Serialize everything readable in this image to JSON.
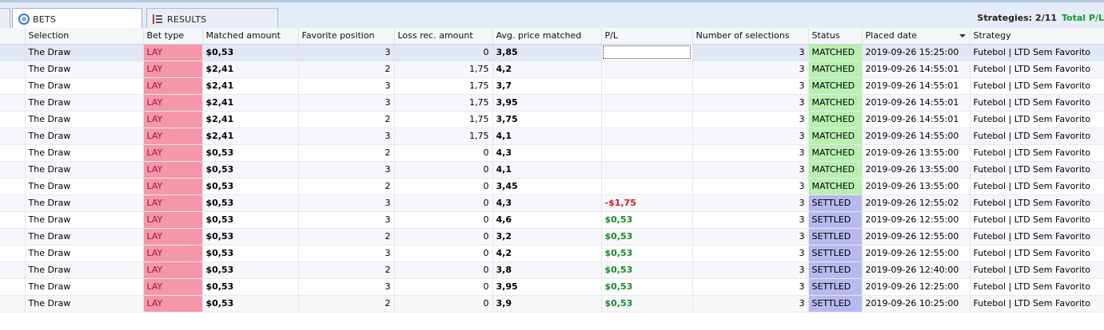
{
  "tabs": {
    "bets_label": "BETS",
    "results_label": "RESULTS"
  },
  "summary": {
    "strategies": "Strategies: 2/11",
    "total_pl": "Total P/L"
  },
  "columns": [
    "Selection",
    "Bet type",
    "Matched amount",
    "Favorite position",
    "Loss rec. amount",
    "Avg. price matched",
    "P/L",
    "Number of selections",
    "Status",
    "Placed date",
    "Strategy"
  ],
  "rows": [
    {
      "selection": "The Draw",
      "bet_type": "LAY",
      "matched": "$0,53",
      "fav_pos": "3",
      "loss_rec": "0",
      "avg_price": "3,85",
      "pl": "",
      "num_sel": "3",
      "status": "MATCHED",
      "placed": "2019-09-26 15:25:00",
      "strategy": "Futebol | LTD Sem Favorito"
    },
    {
      "selection": "The Draw",
      "bet_type": "LAY",
      "matched": "$2,41",
      "fav_pos": "2",
      "loss_rec": "1,75",
      "avg_price": "4,2",
      "pl": "",
      "num_sel": "3",
      "status": "MATCHED",
      "placed": "2019-09-26 14:55:01",
      "strategy": "Futebol | LTD Sem Favorito"
    },
    {
      "selection": "The Draw",
      "bet_type": "LAY",
      "matched": "$2,41",
      "fav_pos": "3",
      "loss_rec": "1,75",
      "avg_price": "3,7",
      "pl": "",
      "num_sel": "3",
      "status": "MATCHED",
      "placed": "2019-09-26 14:55:01",
      "strategy": "Futebol | LTD Sem Favorito"
    },
    {
      "selection": "The Draw",
      "bet_type": "LAY",
      "matched": "$2,41",
      "fav_pos": "3",
      "loss_rec": "1,75",
      "avg_price": "3,95",
      "pl": "",
      "num_sel": "3",
      "status": "MATCHED",
      "placed": "2019-09-26 14:55:01",
      "strategy": "Futebol | LTD Sem Favorito"
    },
    {
      "selection": "The Draw",
      "bet_type": "LAY",
      "matched": "$2,41",
      "fav_pos": "2",
      "loss_rec": "1,75",
      "avg_price": "3,75",
      "pl": "",
      "num_sel": "3",
      "status": "MATCHED",
      "placed": "2019-09-26 14:55:01",
      "strategy": "Futebol | LTD Sem Favorito"
    },
    {
      "selection": "The Draw",
      "bet_type": "LAY",
      "matched": "$2,41",
      "fav_pos": "3",
      "loss_rec": "1,75",
      "avg_price": "4,1",
      "pl": "",
      "num_sel": "3",
      "status": "MATCHED",
      "placed": "2019-09-26 14:55:00",
      "strategy": "Futebol | LTD Sem Favorito"
    },
    {
      "selection": "The Draw",
      "bet_type": "LAY",
      "matched": "$0,53",
      "fav_pos": "2",
      "loss_rec": "0",
      "avg_price": "4,3",
      "pl": "",
      "num_sel": "3",
      "status": "MATCHED",
      "placed": "2019-09-26 13:55:00",
      "strategy": "Futebol | LTD Sem Favorito"
    },
    {
      "selection": "The Draw",
      "bet_type": "LAY",
      "matched": "$0,53",
      "fav_pos": "3",
      "loss_rec": "0",
      "avg_price": "4,1",
      "pl": "",
      "num_sel": "3",
      "status": "MATCHED",
      "placed": "2019-09-26 13:55:00",
      "strategy": "Futebol | LTD Sem Favorito"
    },
    {
      "selection": "The Draw",
      "bet_type": "LAY",
      "matched": "$0,53",
      "fav_pos": "2",
      "loss_rec": "0",
      "avg_price": "3,45",
      "pl": "",
      "num_sel": "3",
      "status": "MATCHED",
      "placed": "2019-09-26 13:55:00",
      "strategy": "Futebol | LTD Sem Favorito"
    },
    {
      "selection": "The Draw",
      "bet_type": "LAY",
      "matched": "$0,53",
      "fav_pos": "3",
      "loss_rec": "0",
      "avg_price": "4,3",
      "pl": "-$1,75",
      "num_sel": "3",
      "status": "SETTLED",
      "placed": "2019-09-26 12:55:02",
      "strategy": "Futebol | LTD Sem Favorito"
    },
    {
      "selection": "The Draw",
      "bet_type": "LAY",
      "matched": "$0,53",
      "fav_pos": "3",
      "loss_rec": "0",
      "avg_price": "4,6",
      "pl": "$0,53",
      "num_sel": "3",
      "status": "SETTLED",
      "placed": "2019-09-26 12:55:00",
      "strategy": "Futebol | LTD Sem Favorito"
    },
    {
      "selection": "The Draw",
      "bet_type": "LAY",
      "matched": "$0,53",
      "fav_pos": "2",
      "loss_rec": "0",
      "avg_price": "3,2",
      "pl": "$0,53",
      "num_sel": "3",
      "status": "SETTLED",
      "placed": "2019-09-26 12:55:00",
      "strategy": "Futebol | LTD Sem Favorito"
    },
    {
      "selection": "The Draw",
      "bet_type": "LAY",
      "matched": "$0,53",
      "fav_pos": "3",
      "loss_rec": "0",
      "avg_price": "4,2",
      "pl": "$0,53",
      "num_sel": "3",
      "status": "SETTLED",
      "placed": "2019-09-26 12:55:00",
      "strategy": "Futebol | LTD Sem Favorito"
    },
    {
      "selection": "The Draw",
      "bet_type": "LAY",
      "matched": "$0,53",
      "fav_pos": "2",
      "loss_rec": "0",
      "avg_price": "3,8",
      "pl": "$0,53",
      "num_sel": "3",
      "status": "SETTLED",
      "placed": "2019-09-26 12:40:00",
      "strategy": "Futebol | LTD Sem Favorito"
    },
    {
      "selection": "The Draw",
      "bet_type": "LAY",
      "matched": "$0,53",
      "fav_pos": "3",
      "loss_rec": "0",
      "avg_price": "3,95",
      "pl": "$0,53",
      "num_sel": "3",
      "status": "SETTLED",
      "placed": "2019-09-26 12:25:00",
      "strategy": "Futebol | LTD Sem Favorito"
    },
    {
      "selection": "The Draw",
      "bet_type": "LAY",
      "matched": "$0,53",
      "fav_pos": "2",
      "loss_rec": "0",
      "avg_price": "3,9",
      "pl": "$0,53",
      "num_sel": "3",
      "status": "SETTLED",
      "placed": "2019-09-26 10:25:00",
      "strategy": "Futebol | LTD Sem Favorito"
    }
  ],
  "colors": {
    "lay_bg": "#f497a8",
    "matched_bg": "#b8f0b0",
    "settled_bg": "#b8b8f0",
    "pl_negative": "#d11d1d",
    "pl_positive": "#1a8a25",
    "total_pl": "#1a9a2a"
  },
  "icons": {
    "bets_tab": "bets-icon",
    "results_tab": "list-icon",
    "sort": "sort-desc-icon"
  }
}
